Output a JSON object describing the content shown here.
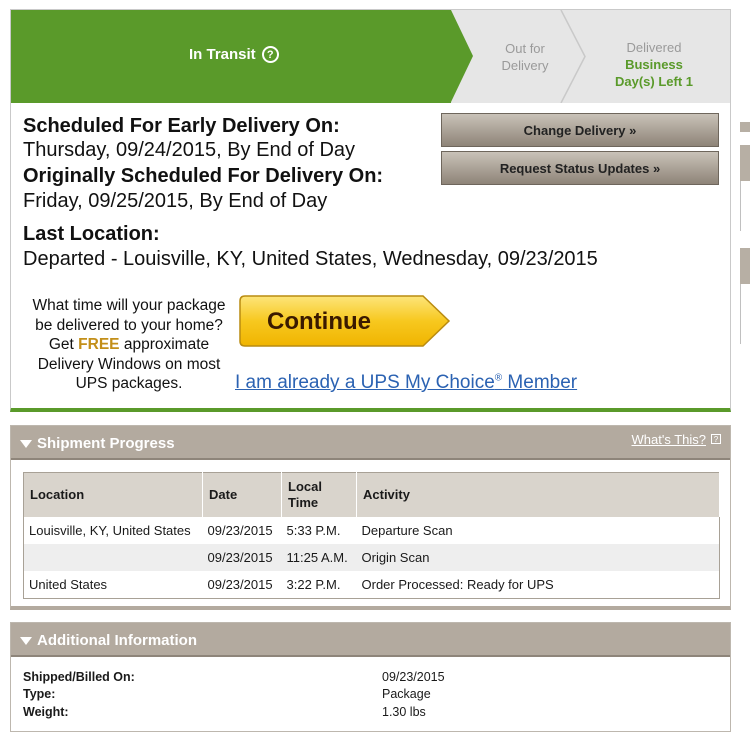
{
  "tracker": {
    "steps": [
      {
        "label": "In Transit",
        "help_icon": "?"
      },
      {
        "label_line1": "Out for",
        "label_line2": "Delivery"
      },
      {
        "label_line1": "Delivered",
        "label_line2": "Business",
        "label_line3": "Day(s) Left 1"
      }
    ]
  },
  "delivery": {
    "early_label": "Scheduled For Early Delivery On:",
    "early_value": "Thursday, 09/24/2015, By End of Day",
    "original_label": "Originally Scheduled For Delivery On:",
    "original_value": "Friday, 09/25/2015, By End of Day",
    "last_location_label": "Last Location:",
    "last_location_value": "Departed - Louisville, KY, United States, Wednesday, 09/23/2015"
  },
  "buttons": {
    "change_delivery": "Change Delivery »",
    "request_updates": "Request Status Updates »",
    "continue": "Continue"
  },
  "promo": {
    "line1": "What time will your package be delivered to your home? Get",
    "free": "FREE",
    "line2": "approximate Delivery Windows on most UPS packages.",
    "member_link_pre": "I am already a UPS My Choice",
    "member_link_reg": "®",
    "member_link_post": " Member"
  },
  "shipment_progress": {
    "title": "Shipment Progress",
    "whats_this": "What's This?",
    "columns": [
      "Location",
      "Date",
      "Local Time",
      "Activity"
    ],
    "rows": [
      {
        "location": "Louisville, KY, United States",
        "date": "09/23/2015",
        "time": "5:33 P.M.",
        "activity": "Departure Scan"
      },
      {
        "location": "",
        "date": "09/23/2015",
        "time": "11:25 A.M.",
        "activity": "Origin Scan"
      },
      {
        "location": "United States",
        "date": "09/23/2015",
        "time": "3:22 P.M.",
        "activity": "Order Processed: Ready for UPS"
      }
    ]
  },
  "additional_info": {
    "title": "Additional Information",
    "fields": [
      {
        "label": "Shipped/Billed On:",
        "value": "09/23/2015"
      },
      {
        "label": "Type:",
        "value": "Package"
      },
      {
        "label": "Weight:",
        "value": "1.30 lbs"
      }
    ]
  },
  "colors": {
    "accent_green": "#5a9a2a",
    "panel_header": "#b3aa9f",
    "link_blue": "#2b62b2",
    "continue_yellow": "#f7c81f"
  }
}
